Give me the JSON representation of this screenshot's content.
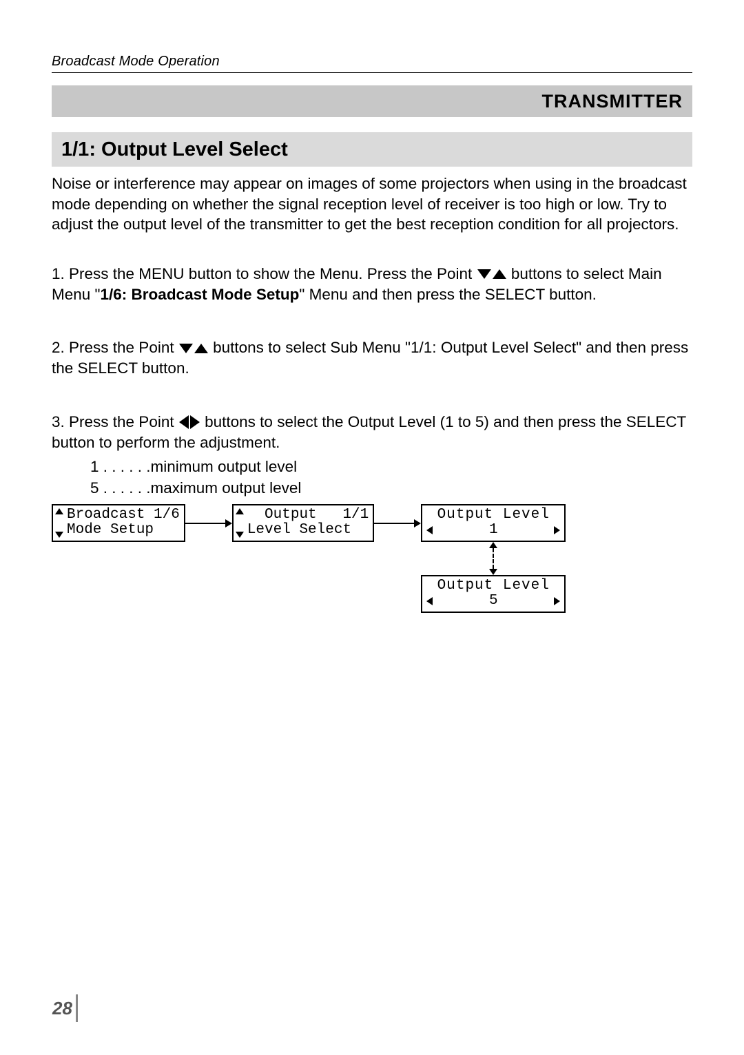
{
  "header": {
    "running_title": "Broadcast Mode Operation"
  },
  "badge": "TRANSMITTER",
  "section": {
    "title": "1/1: Output Level Select"
  },
  "intro": "Noise or interference may appear on images of some projectors when using in the broadcast mode depending on whether the signal reception level of receiver is too high or low. Try to adjust the output level of the transmitter to get the best reception condition for all projectors.",
  "steps": {
    "s1_pre": "1. Press the MENU button to show the Menu. Press the Point ",
    "s1_mid": " buttons to select Main Menu \"",
    "s1_bold": "1/6: Broadcast Mode Setup",
    "s1_post": "\" Menu and then press the SELECT button.",
    "s2_pre": "2. Press the Point ",
    "s2_post": " buttons to select Sub Menu \"1/1: Output Level Select\" and then press the SELECT button.",
    "s3_pre": "3. Press the Point ",
    "s3_post": " buttons to select the Output Level (1 to 5) and then press the SELECT button to perform the adjustment.",
    "legend1": "1 . . . . . .minimum output level",
    "legend5": "5 . . . . . .maximum output level"
  },
  "diagram": {
    "box1_l1": "Broadcast 1/6",
    "box1_l2": "Mode Setup",
    "box2_l1": "  Output   1/1",
    "box2_l2": "Level Select",
    "level_title": "Output Level",
    "level_val_1": "1",
    "level_val_5": "5"
  },
  "page_number": "28"
}
